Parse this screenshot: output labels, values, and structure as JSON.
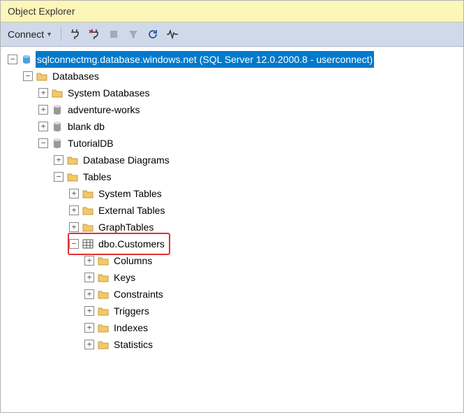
{
  "title": "Object Explorer",
  "toolbar": {
    "connect_label": "Connect",
    "icons": {
      "plug": "plug-icon",
      "plug_x": "disconnect-icon",
      "stop": "stop-icon",
      "filter": "filter-icon",
      "refresh": "refresh-icon",
      "activity": "activity-monitor-icon"
    }
  },
  "root": {
    "label": "sqlconnectmg.database.windows.net (SQL Server 12.0.2000.8 - userconnect)"
  },
  "databases": {
    "label": "Databases",
    "items": {
      "system": "System Databases",
      "adventure": "adventure-works",
      "blank": "blank db",
      "tutorial": "TutorialDB"
    }
  },
  "tutorial": {
    "diagrams": "Database Diagrams",
    "tables_label": "Tables",
    "tables": {
      "system": "System Tables",
      "external": "External Tables",
      "graph": "GraphTables",
      "customers": "dbo.Customers"
    }
  },
  "customers_children": {
    "columns": "Columns",
    "keys": "Keys",
    "constraints": "Constraints",
    "triggers": "Triggers",
    "indexes": "Indexes",
    "statistics": "Statistics"
  }
}
